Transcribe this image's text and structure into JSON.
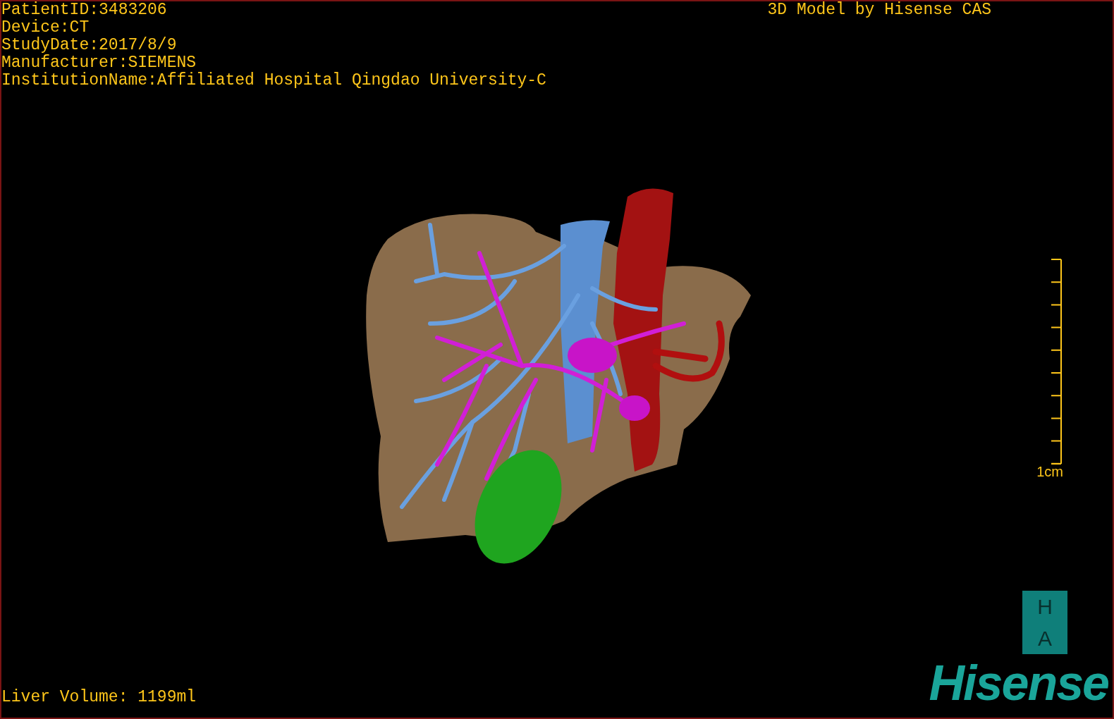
{
  "patient_info": [
    "PatientID:3483206",
    "Device:CT",
    "StudyDate:2017/8/9",
    "Manufacturer:SIEMENS",
    "InstitutionName:Affiliated Hospital Qingdao University-C"
  ],
  "title": "3D Model by Hisense CAS",
  "scale_bar": {
    "label": "1cm"
  },
  "liver_volume": "Liver Volume: 1199ml",
  "orientation_marker": {
    "top": "H",
    "bottom": "A"
  },
  "logo": "Hisense"
}
